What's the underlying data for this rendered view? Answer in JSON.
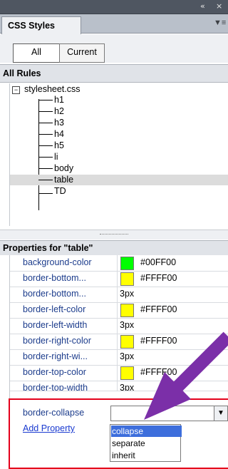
{
  "window": {
    "collapse_glyph": "«",
    "close_glyph": "×",
    "menu_glyph": "▼≡"
  },
  "tabs": {
    "css_styles": "CSS Styles"
  },
  "toggle": {
    "all": "All",
    "current": "Current"
  },
  "all_rules": {
    "header": "All Rules",
    "stylesheet": "stylesheet.css",
    "rules": [
      "h1",
      "h2",
      "h3",
      "h4",
      "h5",
      "li",
      "body",
      "table",
      "TD"
    ],
    "selected": "table"
  },
  "properties": {
    "header": "Properties for \"table\"",
    "rows": [
      {
        "name": "background-color",
        "value": "#00FF00",
        "swatch": "#00ff00"
      },
      {
        "name": "border-bottom...",
        "value": "#FFFF00",
        "swatch": "#ffff00"
      },
      {
        "name": "border-bottom...",
        "value": "3px"
      },
      {
        "name": "border-left-color",
        "value": "#FFFF00",
        "swatch": "#ffff00"
      },
      {
        "name": "border-left-width",
        "value": "3px"
      },
      {
        "name": "border-right-color",
        "value": "#FFFF00",
        "swatch": "#ffff00"
      },
      {
        "name": "border-right-wi...",
        "value": "3px"
      },
      {
        "name": "border-top-color",
        "value": "#FFFF00",
        "swatch": "#ffff00"
      },
      {
        "name": "border-top-width",
        "value": "3px"
      }
    ],
    "new_property": "border-collapse",
    "add_property": "Add Property",
    "dropdown_options": [
      "collapse",
      "separate",
      "inherit"
    ],
    "highlighted_option": "collapse"
  },
  "colors": {
    "highlight_box": "#e4001b",
    "arrow": "#7b2fa8",
    "selection": "#3d6edc"
  }
}
